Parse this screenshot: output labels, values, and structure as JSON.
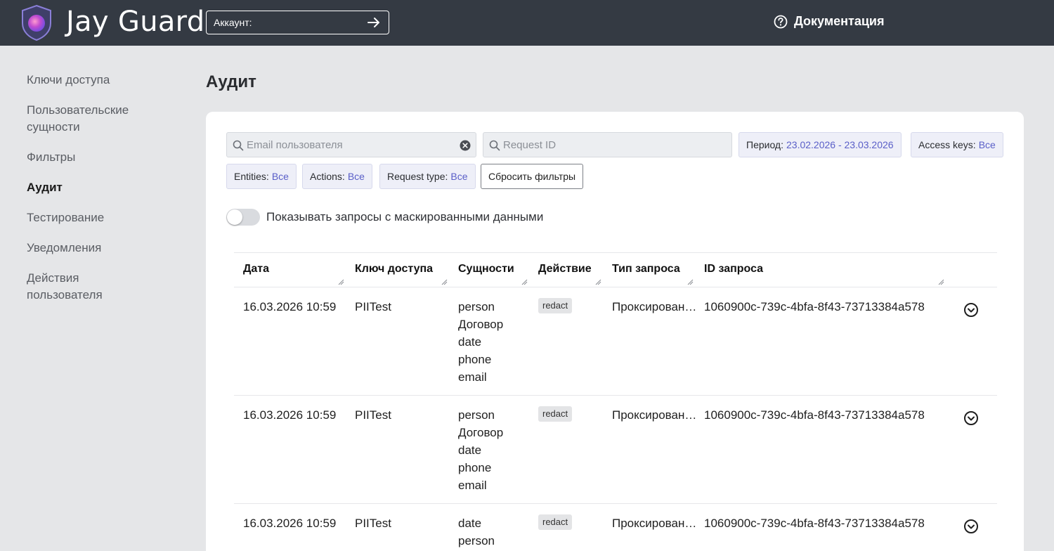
{
  "header": {
    "brand": "Jay Guard",
    "account_label": "Аккаунт:",
    "docs_label": "Документация"
  },
  "sidebar": {
    "items": [
      {
        "label": "Ключи доступа"
      },
      {
        "label": "Пользовательские сущности"
      },
      {
        "label": "Фильтры"
      },
      {
        "label": "Аудит",
        "active": true
      },
      {
        "label": "Тестирование"
      },
      {
        "label": "Уведомления"
      },
      {
        "label": "Действия пользователя"
      }
    ]
  },
  "page": {
    "title": "Аудит"
  },
  "filters": {
    "email_placeholder": "Email пользователя",
    "request_id_placeholder": "Request ID",
    "period_label": "Период:",
    "period_value": "23.02.2026 - 23.03.2026",
    "access_keys_label": "Access keys:",
    "access_keys_value": "Все",
    "entities_label": "Entities:",
    "entities_value": "Все",
    "actions_label": "Actions:",
    "actions_value": "Все",
    "request_type_label": "Request type:",
    "request_type_value": "Все",
    "reset_label": "Сбросить фильтры",
    "masked_toggle_label": "Показывать запросы с маскированными данными",
    "masked_toggle_on": false
  },
  "table": {
    "columns": [
      "Дата",
      "Ключ доступа",
      "Сущности",
      "Действие",
      "Тип запроса",
      "ID запроса"
    ],
    "rows": [
      {
        "date": "16.03.2026 10:59",
        "access_key": "PIITest",
        "entities": [
          "person",
          "Договор",
          "date",
          "phone",
          "email"
        ],
        "action": "redact",
        "request_type": "Проксирован…",
        "request_id": "1060900c-739c-4bfa-8f43-73713384a578"
      },
      {
        "date": "16.03.2026 10:59",
        "access_key": "PIITest",
        "entities": [
          "person",
          "Договор",
          "date",
          "phone",
          "email"
        ],
        "action": "redact",
        "request_type": "Проксирован…",
        "request_id": "1060900c-739c-4bfa-8f43-73713384a578"
      },
      {
        "date": "16.03.2026 10:59",
        "access_key": "PIITest",
        "entities": [
          "date",
          "person"
        ],
        "action": "redact",
        "request_type": "Проксирован…",
        "request_id": "1060900c-739c-4bfa-8f43-73713384a578"
      }
    ]
  },
  "colors": {
    "header_bg": "#343a43",
    "accent": "#5a5fc8",
    "page_bg": "#e5e6e8"
  },
  "icons": {
    "logo": "shield-logo-icon",
    "account_submit": "arrow-right-icon",
    "docs": "help-circle-icon",
    "search": "search-icon",
    "clear": "clear-icon",
    "expand": "chevron-down-circle-icon"
  }
}
